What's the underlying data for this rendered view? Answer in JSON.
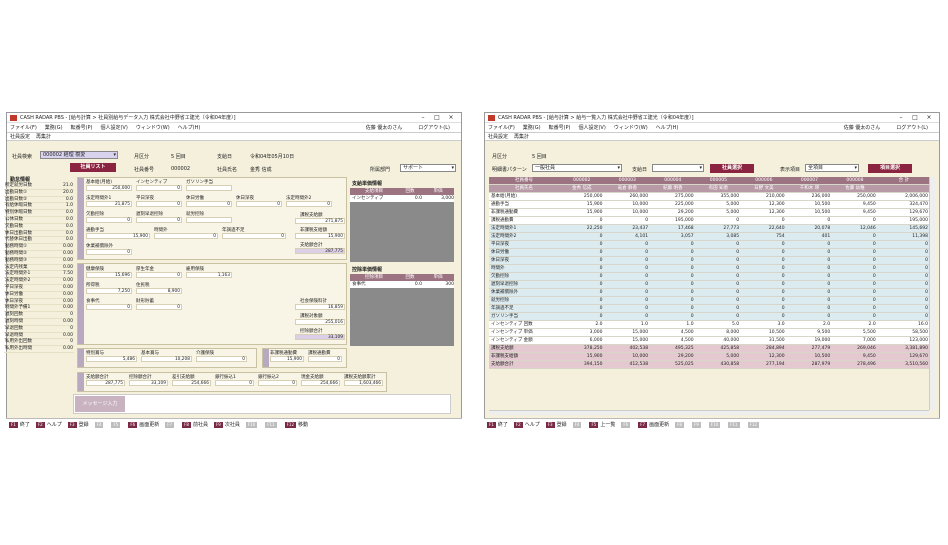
{
  "left": {
    "title": "CASH RADAR PBS - [給与計算 > 社員別給与データ入力 株式会社中野省エ建光（令和04年度）]",
    "menu": [
      "ファイル(F)",
      "業務(G)",
      "転番号(P)",
      "個人設定(V)",
      "ウィンドウ(W)",
      "ヘルプ(H)"
    ],
    "user": "佐藤 優太のさん",
    "logout": "ログアウト(L)",
    "tabs": [
      "社員設定",
      "再集計"
    ],
    "search_label": "社員検索",
    "search_value": "000002 経理 樹愛",
    "list_btn": "社員リスト",
    "kubun_label": "月区分",
    "kubun": "5 回目",
    "shikyu_label": "支給日",
    "shikyu": "令和04年05月10日",
    "no_label": "社員番号",
    "no": "000002",
    "name_label": "社員氏名",
    "name": "金秀 信成",
    "dept_label": "所属部門",
    "dept": "サポート",
    "kintai_title": "勤怠情報",
    "kintai": [
      [
        "所定就労日数",
        "21.0"
      ],
      [
        "出勤日数①",
        "20.0"
      ],
      [
        "出勤日数②",
        "0.0"
      ],
      [
        "有給休暇日数",
        "1.0"
      ],
      [
        "特別休暇日数",
        "0.0"
      ],
      [
        "公休日数",
        "0.0"
      ],
      [
        "欠勤日数",
        "0.0"
      ],
      [
        "休日出勤日数",
        "0.0"
      ],
      [
        "代替休日出勤",
        "0.0"
      ],
      [
        "勤務時間①",
        "0.00"
      ],
      [
        "勤務時間②",
        "0.00"
      ],
      [
        "勤務時間③",
        "0.00"
      ],
      [
        "法定内残業",
        "0.00"
      ],
      [
        "法定時間外1",
        "7.50"
      ],
      [
        "法定時間外2",
        "0.00"
      ],
      [
        "平日深夜",
        "0.00"
      ],
      [
        "休日労働",
        "0.00"
      ],
      [
        "休日深夜",
        "0.00"
      ],
      [
        "時間外予備1",
        "0.00"
      ],
      [
        "遅刻回数",
        "0"
      ],
      [
        "遅刻時間",
        "0.00"
      ],
      [
        "早退回数",
        "0"
      ],
      [
        "早退時間",
        "0.00"
      ],
      [
        "私用外出回数",
        "0"
      ],
      [
        "私用外出時間",
        "0.00"
      ]
    ],
    "shikyu_group": {
      "h1": [
        "基本給(月給)",
        "インセンティブ",
        "ガソリン手当"
      ],
      "v1": [
        "250,000",
        "0",
        ""
      ],
      "h2": [
        "法定時間外1",
        "平日深夜",
        "休日労働",
        "休日深夜",
        "法定時間外2"
      ],
      "v2": [
        "21,875",
        "0",
        "0",
        "0",
        "0"
      ],
      "h3": [
        "欠勤控除",
        "遅刻早退控除",
        "就労控除"
      ],
      "v3": [
        "0",
        "0",
        ""
      ],
      "h4": [
        "通勤手当",
        "時間外",
        "年調過不足"
      ],
      "v4": [
        "15,900",
        "0",
        "0"
      ],
      "h5": [
        "休業補償除外"
      ],
      "v5": [
        "0"
      ],
      "sum_labels": [
        "課税支給額",
        "非課税支給額",
        "支給額合計"
      ],
      "sums": [
        "271,875",
        "15,900",
        "287,775"
      ]
    },
    "kojo_group": {
      "h1": [
        "健康保険",
        "厚生年金",
        "雇用保険"
      ],
      "v1": [
        "15,696",
        "0",
        "1,163"
      ],
      "h2": [
        "所得税",
        "住民税"
      ],
      "v2": [
        "7,250",
        "8,900"
      ],
      "h3": [
        "食事代",
        "財形貯蓄"
      ],
      "v3": [
        "0",
        "0"
      ],
      "sum_labels": [
        "社会保険料計",
        "課税対象額",
        "控除額合計"
      ],
      "sums": [
        "16,859",
        "255,016",
        "33,109"
      ]
    },
    "kyuyo_title": "支給単価情報",
    "kyuyo_cols": [
      "支給項目",
      "回数",
      "単価"
    ],
    "kyuyo_row": [
      "インセンティブ",
      "0.0",
      "3,000"
    ],
    "kojo_title": "控除単価情報",
    "kojo_cols": [
      "控除項目",
      "回数",
      "単価"
    ],
    "kojo_row": [
      "食事代",
      "0.0",
      "300"
    ],
    "kijun": {
      "h": [
        "特別賞与",
        "基本賞与",
        "介護保険"
      ],
      "v": [
        "5,486",
        "10,208",
        "0"
      ]
    },
    "hikazei": {
      "h": [
        "非課税通勤費",
        "課税通勤費"
      ],
      "v": [
        "15,900",
        "0"
      ]
    },
    "bottom": {
      "h": [
        "支給額合計",
        "控除額合計",
        "差引支給額",
        "銀行振込1",
        "銀行振込2",
        "現金支給額",
        "課税支給額累計"
      ],
      "v": [
        "287,775",
        "33,109",
        "254,666",
        "0",
        "0",
        "254,666",
        "1,603,466"
      ]
    },
    "msg_btn": "メッセージ入力",
    "fkeys": [
      [
        "F1",
        "終了",
        true
      ],
      [
        "F2",
        "ヘルプ",
        true
      ],
      [
        "F3",
        "登録",
        true
      ],
      [
        "F4",
        "",
        false
      ],
      [
        "F5",
        "",
        false
      ],
      [
        "F6",
        "画面更新",
        true
      ],
      [
        "F7",
        "",
        false
      ],
      [
        "F8",
        "前社員",
        true
      ],
      [
        "F9",
        "次社員",
        true
      ],
      [
        "F10",
        "",
        false
      ],
      [
        "F11",
        "",
        false
      ],
      [
        "F12",
        "移動",
        true
      ]
    ]
  },
  "right": {
    "title": "CASH RADAR PBS - [給与計算 > 給与一覧入力 株式会社中野省エ建光（令和04年度）]",
    "menu": [
      "ファイル(F)",
      "業務(G)",
      "転番号(P)",
      "個人設定(V)",
      "ウィンドウ(W)",
      "ヘルプ(H)"
    ],
    "user": "佐藤 優太のさん",
    "logout": "ログアウト(L)",
    "tabs": [
      "社員設定",
      "再集計"
    ],
    "kubun_label": "月区分",
    "kubun": "5 回目",
    "pattern_label": "明細書パターン",
    "pattern": "一般社員",
    "shikyu_label": "支給日",
    "select_btn": "社員選択",
    "disp_label": "表示項目",
    "disp": "全項目",
    "item_btn": "項目選択",
    "col_head": [
      "社員番号",
      "000002",
      "000003",
      "000004",
      "000005",
      "000006",
      "000007",
      "000008",
      "合 計"
    ],
    "col_sub": [
      "社員氏名",
      "金秀 信成",
      "竜倉 静香",
      "紀藤 明香",
      "有田 知恵",
      "日野 文美",
      "千和木 瑛",
      "佐藤 幼稚",
      ""
    ],
    "rows": [
      [
        "基本給(月給)",
        "250,000",
        "260,000",
        "275,000",
        "355,000",
        "210,000",
        "236,000",
        "250,000",
        "2,006,000",
        "wh"
      ],
      [
        "通勤手当",
        "15,900",
        "10,000",
        "225,000",
        "5,000",
        "12,300",
        "10,500",
        "9,450",
        "324,470",
        "wh"
      ],
      [
        "非課税通勤費",
        "15,900",
        "10,000",
        "29,200",
        "5,000",
        "12,300",
        "10,500",
        "9,450",
        "129,670",
        "wh"
      ],
      [
        "課税通勤費",
        "0",
        "0",
        "195,000",
        "0",
        "0",
        "0",
        "0",
        "195,000",
        "wh"
      ],
      [
        "法定時間外1",
        "22,250",
        "23,437",
        "17,468",
        "27,773",
        "22,640",
        "20,078",
        "12,046",
        "145,692",
        "cy"
      ],
      [
        "法定時間外2",
        "0",
        "4,101",
        "3,057",
        "3,085",
        "754",
        "401",
        "0",
        "11,398",
        "cy"
      ],
      [
        "平日深夜",
        "0",
        "0",
        "0",
        "0",
        "0",
        "0",
        "0",
        "0",
        "cy"
      ],
      [
        "休日労働",
        "0",
        "0",
        "0",
        "0",
        "0",
        "0",
        "0",
        "0",
        "cy"
      ],
      [
        "休日深夜",
        "0",
        "0",
        "0",
        "0",
        "0",
        "0",
        "0",
        "0",
        "cy"
      ],
      [
        "時間外",
        "0",
        "0",
        "0",
        "0",
        "0",
        "0",
        "0",
        "0",
        "cy"
      ],
      [
        "欠勤控除",
        "0",
        "0",
        "0",
        "0",
        "0",
        "0",
        "0",
        "0",
        "cy"
      ],
      [
        "遅刻早退控除",
        "0",
        "0",
        "0",
        "0",
        "0",
        "0",
        "0",
        "0",
        "cy"
      ],
      [
        "休業補償除外",
        "0",
        "0",
        "0",
        "0",
        "0",
        "0",
        "0",
        "0",
        "cy"
      ],
      [
        "就労控除",
        "0",
        "0",
        "0",
        "0",
        "0",
        "0",
        "0",
        "0",
        "cy"
      ],
      [
        "年調過不足",
        "0",
        "0",
        "0",
        "0",
        "0",
        "0",
        "0",
        "0",
        "cy"
      ],
      [
        "ガソリン手当",
        "0",
        "0",
        "0",
        "0",
        "0",
        "0",
        "0",
        "0",
        "cy"
      ],
      [
        "インセンティブ 回数",
        "2.0",
        "1.0",
        "1.0",
        "5.0",
        "3.0",
        "2.0",
        "2.0",
        "16.0",
        "wh"
      ],
      [
        "インセンティブ 単価",
        "3,000",
        "15,000",
        "4,500",
        "8,000",
        "10,500",
        "9,500",
        "5,500",
        "58,500",
        "wh"
      ],
      [
        "インセンティブ 金額",
        "6,000",
        "15,000",
        "4,500",
        "40,000",
        "31,500",
        "19,000",
        "7,000",
        "123,000",
        "wh"
      ],
      [
        "課税支給額",
        "378,250",
        "402,538",
        "495,325",
        "425,858",
        "284,894",
        "277,479",
        "269,046",
        "3,381,890",
        "tot"
      ],
      [
        "非課税支給額",
        "15,900",
        "10,000",
        "29,200",
        "5,000",
        "12,300",
        "10,500",
        "9,450",
        "129,670",
        "tot"
      ],
      [
        "支給額合計",
        "394,150",
        "412,538",
        "525,025",
        "430,858",
        "277,194",
        "287,979",
        "278,496",
        "3,510,560",
        "tot"
      ]
    ],
    "fkeys": [
      [
        "F1",
        "終了",
        true
      ],
      [
        "F2",
        "ヘルプ",
        true
      ],
      [
        "F3",
        "登録",
        true
      ],
      [
        "F4",
        "",
        false
      ],
      [
        "F5",
        "上一覧",
        true
      ],
      [
        "F6",
        "",
        false
      ],
      [
        "F7",
        "画面更新",
        true
      ],
      [
        "F8",
        "",
        false
      ],
      [
        "F9",
        "",
        false
      ],
      [
        "F10",
        "",
        false
      ],
      [
        "F11",
        "",
        false
      ],
      [
        "F12",
        "",
        false
      ]
    ]
  }
}
